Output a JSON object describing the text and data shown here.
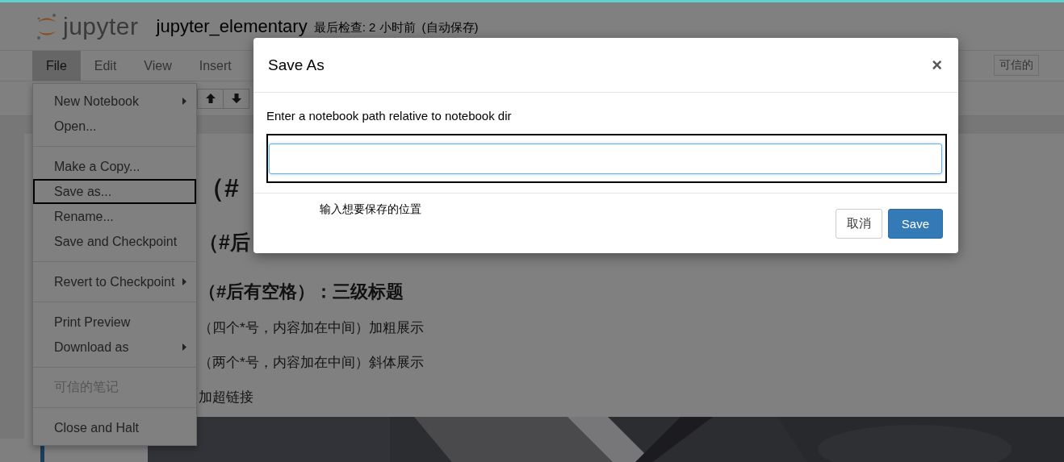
{
  "header": {
    "logo_text": "jupyter",
    "notebook_title": "jupyter_elementary",
    "checkpoint": "最后检查: 2 小时前",
    "autosave": "(自动保存)"
  },
  "menubar": [
    {
      "label": "File",
      "selected": true
    },
    {
      "label": "Edit",
      "selected": false
    },
    {
      "label": "View",
      "selected": false
    },
    {
      "label": "Insert",
      "selected": false
    }
  ],
  "trusted_badge": "可信的",
  "toolbar": [
    {
      "kind": "up"
    },
    {
      "kind": "down"
    }
  ],
  "file_menu": [
    [
      {
        "label": "New Notebook",
        "submenu": true,
        "outlined": false,
        "disabled": false
      },
      {
        "label": "Open...",
        "submenu": false,
        "outlined": false,
        "disabled": false
      }
    ],
    [
      {
        "label": "Make a Copy...",
        "submenu": false,
        "outlined": false,
        "disabled": false
      },
      {
        "label": "Save as...",
        "submenu": false,
        "outlined": true,
        "disabled": false
      },
      {
        "label": "Rename...",
        "submenu": false,
        "outlined": false,
        "disabled": false
      },
      {
        "label": "Save and Checkpoint",
        "submenu": false,
        "outlined": false,
        "disabled": false
      }
    ],
    [
      {
        "label": "Revert to Checkpoint",
        "submenu": true,
        "outlined": false,
        "disabled": false
      }
    ],
    [
      {
        "label": "Print Preview",
        "submenu": false,
        "outlined": false,
        "disabled": false
      },
      {
        "label": "Download as",
        "submenu": true,
        "outlined": false,
        "disabled": false
      }
    ],
    [
      {
        "label": "可信的笔记",
        "submenu": false,
        "outlined": false,
        "disabled": true
      }
    ],
    [
      {
        "label": "Close and Halt",
        "submenu": false,
        "outlined": false,
        "disabled": false
      }
    ]
  ],
  "content": [
    {
      "kind": "h1",
      "text": "（#"
    },
    {
      "kind": "h2",
      "text": "（#后"
    },
    {
      "kind": "h3",
      "text": "（#后有空格）：三级标题"
    },
    {
      "kind": "p",
      "text": "（四个*号，内容加在中间）加粗展示"
    },
    {
      "kind": "p",
      "text": "（两个*号，内容加在中间）斜体展示"
    },
    {
      "kind": "p",
      "text": "加超链接"
    },
    {
      "kind": "picture"
    }
  ],
  "dialog": {
    "title": "Save As",
    "close": "×",
    "label": "Enter a notebook path relative to notebook dir",
    "input": {
      "outlined": true
    },
    "annotation": "输入想要保存的位置",
    "buttons": [
      {
        "label": "取消",
        "kind": "default"
      },
      {
        "label": "Save",
        "kind": "primary"
      }
    ]
  }
}
